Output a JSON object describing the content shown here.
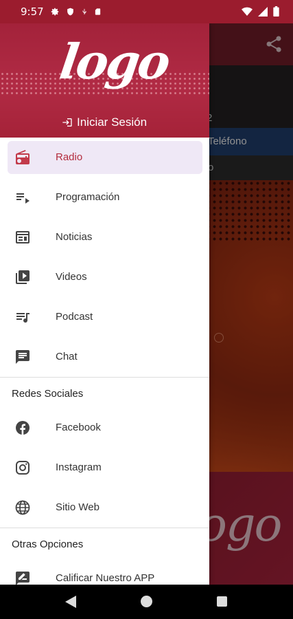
{
  "status_bar": {
    "time": "9:57"
  },
  "background": {
    "row_label": "2",
    "phone_label": "Teléfono",
    "gray_label": "o",
    "logo_text": "ogo"
  },
  "drawer": {
    "logo_text": "logo",
    "login_label": "Iniciar Sesión",
    "main_items": [
      {
        "label": "Radio",
        "icon": "radio-icon",
        "active": true
      },
      {
        "label": "Programación",
        "icon": "playlist-icon"
      },
      {
        "label": "Noticias",
        "icon": "news-icon"
      },
      {
        "label": "Videos",
        "icon": "video-library-icon"
      },
      {
        "label": "Podcast",
        "icon": "queue-music-icon"
      },
      {
        "label": "Chat",
        "icon": "chat-icon"
      }
    ],
    "social_title": "Redes Sociales",
    "social_items": [
      {
        "label": "Facebook",
        "icon": "facebook-icon"
      },
      {
        "label": "Instagram",
        "icon": "instagram-icon"
      },
      {
        "label": "Sitio Web",
        "icon": "globe-icon"
      }
    ],
    "other_title": "Otras Opciones",
    "other_items": [
      {
        "label": "Calificar Nuestro APP",
        "icon": "rate-review-icon"
      }
    ]
  },
  "colors": {
    "accent": "#b32c3d",
    "header": "#a3223a",
    "selected_bg": "#efe8f6"
  }
}
